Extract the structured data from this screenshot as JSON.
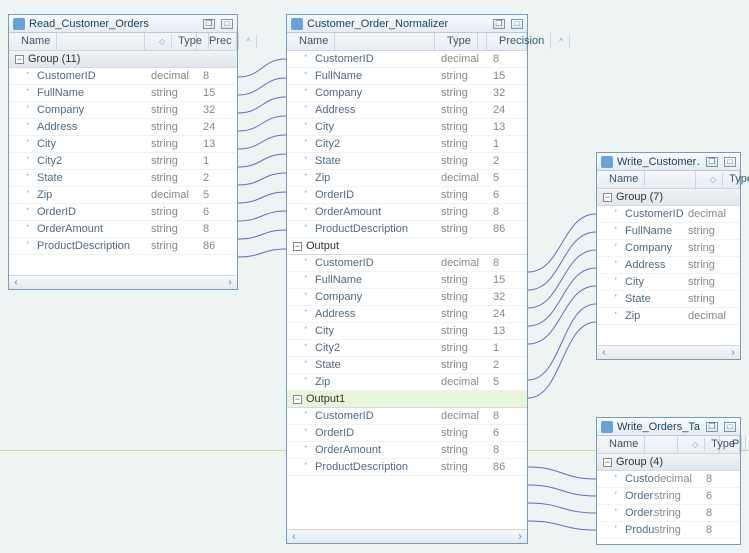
{
  "panels": {
    "read": {
      "title": "Read_Customer_Orders",
      "cols": [
        "Name",
        "Type",
        "Prec"
      ],
      "group": "Group (11)",
      "fields": [
        {
          "name": "CustomerID",
          "type": "decimal",
          "prec": "8"
        },
        {
          "name": "FullName",
          "type": "string",
          "prec": "15"
        },
        {
          "name": "Company",
          "type": "string",
          "prec": "32"
        },
        {
          "name": "Address",
          "type": "string",
          "prec": "24"
        },
        {
          "name": "City",
          "type": "string",
          "prec": "13"
        },
        {
          "name": "City2",
          "type": "string",
          "prec": "1"
        },
        {
          "name": "State",
          "type": "string",
          "prec": "2"
        },
        {
          "name": "Zip",
          "type": "decimal",
          "prec": "5"
        },
        {
          "name": "OrderID",
          "type": "string",
          "prec": "6"
        },
        {
          "name": "OrderAmount",
          "type": "string",
          "prec": "8"
        },
        {
          "name": "ProductDescription",
          "type": "string",
          "prec": "86"
        }
      ]
    },
    "norm": {
      "title": "Customer_Order_Normalizer",
      "cols": [
        "Name",
        "Type",
        "Precision"
      ],
      "input": [
        {
          "name": "CustomerID",
          "type": "decimal",
          "prec": "8"
        },
        {
          "name": "FullName",
          "type": "string",
          "prec": "15"
        },
        {
          "name": "Company",
          "type": "string",
          "prec": "32"
        },
        {
          "name": "Address",
          "type": "string",
          "prec": "24"
        },
        {
          "name": "City",
          "type": "string",
          "prec": "13"
        },
        {
          "name": "City2",
          "type": "string",
          "prec": "1"
        },
        {
          "name": "State",
          "type": "string",
          "prec": "2"
        },
        {
          "name": "Zip",
          "type": "decimal",
          "prec": "5"
        },
        {
          "name": "OrderID",
          "type": "string",
          "prec": "6"
        },
        {
          "name": "OrderAmount",
          "type": "string",
          "prec": "8"
        },
        {
          "name": "ProductDescription",
          "type": "string",
          "prec": "86"
        }
      ],
      "outLabel": "Output",
      "output": [
        {
          "name": "CustomerID",
          "type": "decimal",
          "prec": "8"
        },
        {
          "name": "FullName",
          "type": "string",
          "prec": "15"
        },
        {
          "name": "Company",
          "type": "string",
          "prec": "32"
        },
        {
          "name": "Address",
          "type": "string",
          "prec": "24"
        },
        {
          "name": "City",
          "type": "string",
          "prec": "13"
        },
        {
          "name": "City2",
          "type": "string",
          "prec": "1"
        },
        {
          "name": "State",
          "type": "string",
          "prec": "2"
        },
        {
          "name": "Zip",
          "type": "decimal",
          "prec": "5"
        }
      ],
      "out1Label": "Output1",
      "output1": [
        {
          "name": "CustomerID",
          "type": "decimal",
          "prec": "8"
        },
        {
          "name": "OrderID",
          "type": "string",
          "prec": "6"
        },
        {
          "name": "OrderAmount",
          "type": "string",
          "prec": "8"
        },
        {
          "name": "ProductDescription",
          "type": "string",
          "prec": "86"
        }
      ]
    },
    "wcust": {
      "title": "Write_Customer…",
      "cols": [
        "Name",
        "Type"
      ],
      "group": "Group (7)",
      "fields": [
        {
          "name": "CustomerID",
          "type": "decimal"
        },
        {
          "name": "FullName",
          "type": "string"
        },
        {
          "name": "Company",
          "type": "string"
        },
        {
          "name": "Address",
          "type": "string"
        },
        {
          "name": "City",
          "type": "string"
        },
        {
          "name": "State",
          "type": "string"
        },
        {
          "name": "Zip",
          "type": "decimal"
        }
      ]
    },
    "word": {
      "title": "Write_Orders_Target",
      "cols": [
        "Name",
        "Type",
        "P"
      ],
      "group": "Group (4)",
      "fields": [
        {
          "name": "CustomerID",
          "type": "decimal",
          "prec": "8"
        },
        {
          "name": "OrderID",
          "type": "string",
          "prec": "6"
        },
        {
          "name": "OrderAm…",
          "type": "string",
          "prec": "8"
        },
        {
          "name": "ProductD…",
          "type": "string",
          "prec": "8"
        }
      ]
    }
  },
  "glyph": {
    "minus": "−",
    "restore": "❐",
    "max": "□",
    "left": "‹",
    "right": "›"
  }
}
